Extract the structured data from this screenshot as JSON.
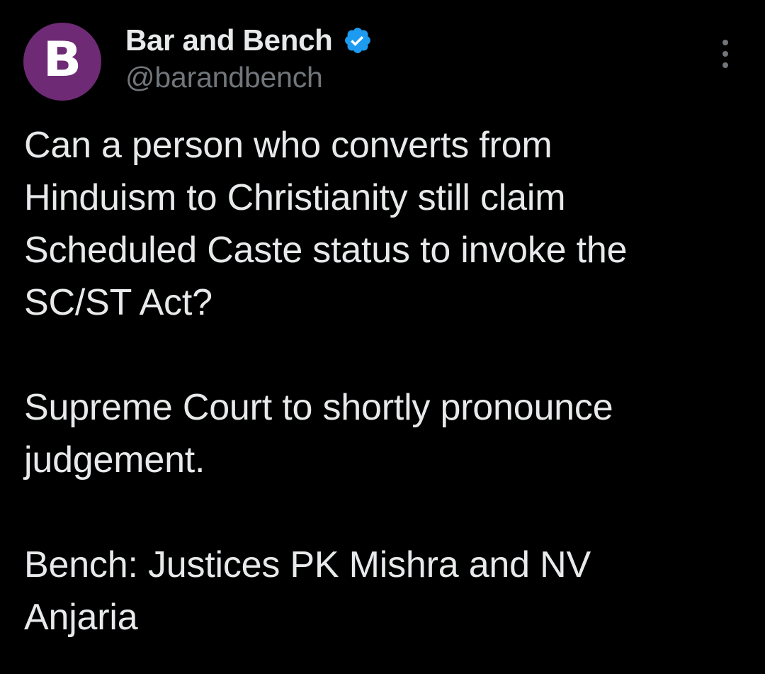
{
  "author": {
    "avatar_letter": "B",
    "display_name": "Bar and Bench",
    "handle": "@barandbench",
    "verified": true,
    "avatar_color": "#6e2a75",
    "verified_color": "#1d9bf0"
  },
  "menu": {
    "icon": "more-options-icon"
  },
  "tweet": {
    "paragraphs": [
      "Can a person who converts from\nHinduism to Christianity still claim\nScheduled Caste status to invoke the\nSC/ST Act?",
      "Supreme Court to shortly pronounce\njudgement.",
      "Bench: Justices PK Mishra and NV\nAnjaria"
    ]
  },
  "colors": {
    "background": "#000000",
    "text": "#e7e9ea",
    "secondary_text": "#71767b"
  }
}
